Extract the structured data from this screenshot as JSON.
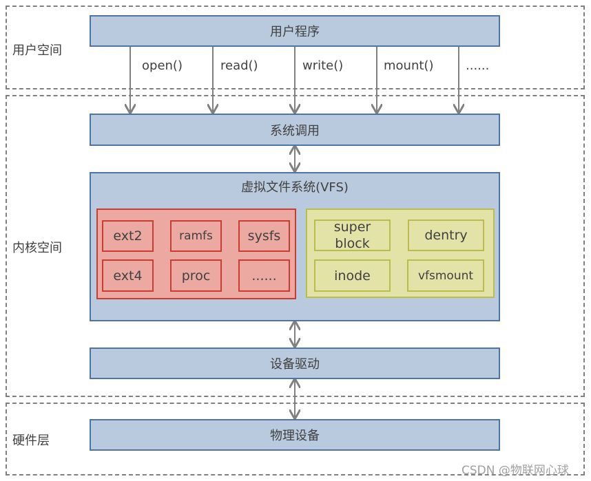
{
  "regions": {
    "user": "用户空间",
    "kernel": "内核空间",
    "hardware": "硬件层"
  },
  "boxes": {
    "user_program": "用户程序",
    "syscall": "系统调用",
    "vfs": "虚拟文件系统(VFS)",
    "driver": "设备驱动",
    "device": "物理设备"
  },
  "calls": [
    "open()",
    "read()",
    "write()",
    "mount()",
    "......"
  ],
  "filesystems": [
    "ext2",
    "ramfs",
    "sysfs",
    "ext4",
    "proc",
    "......"
  ],
  "vfs_objects": [
    "super block",
    "dentry",
    "inode",
    "vfsmount"
  ],
  "watermark": "CSDN @物联网心球",
  "colors": {
    "box_fill": "#b9c9de",
    "box_border": "#4e73a6",
    "fs_fill": "#eba9a2",
    "fs_border": "#cc3a30",
    "obj_fill": "#e3e3a7",
    "obj_border": "#bcbc4c"
  }
}
